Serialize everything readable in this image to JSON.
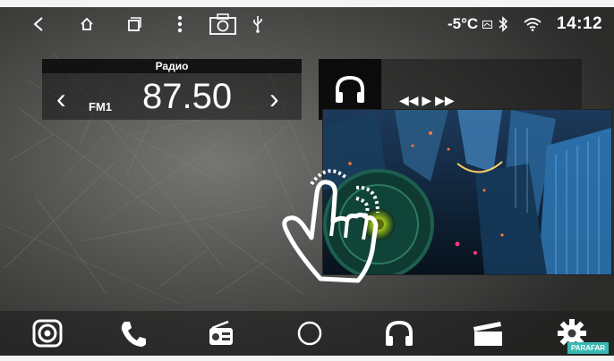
{
  "status_bar": {
    "temperature": "-5°C",
    "time": "14:12",
    "icons": [
      "back-icon",
      "home-icon",
      "recents-icon",
      "menu-dots-icon",
      "camera-icon",
      "usb-icon",
      "gps-status-icon",
      "bluetooth-icon",
      "wifi-icon"
    ]
  },
  "radio": {
    "title": "Радио",
    "band": "FM1",
    "frequency": "87.50",
    "prev_glyph": "‹",
    "next_glyph": "›"
  },
  "music": {
    "icon": "headphones-icon",
    "controls_glyph": "◀◀    ▶    ▶▶"
  },
  "dock": {
    "items": [
      "camera-lens-icon",
      "phone-icon",
      "radio-icon",
      "home-circle-icon",
      "headphones-icon",
      "video-icon",
      "settings-icon"
    ]
  },
  "brand": {
    "label": "PARAFAR"
  },
  "colors": {
    "accent": "#38b9b2",
    "text": "#ffffff"
  }
}
